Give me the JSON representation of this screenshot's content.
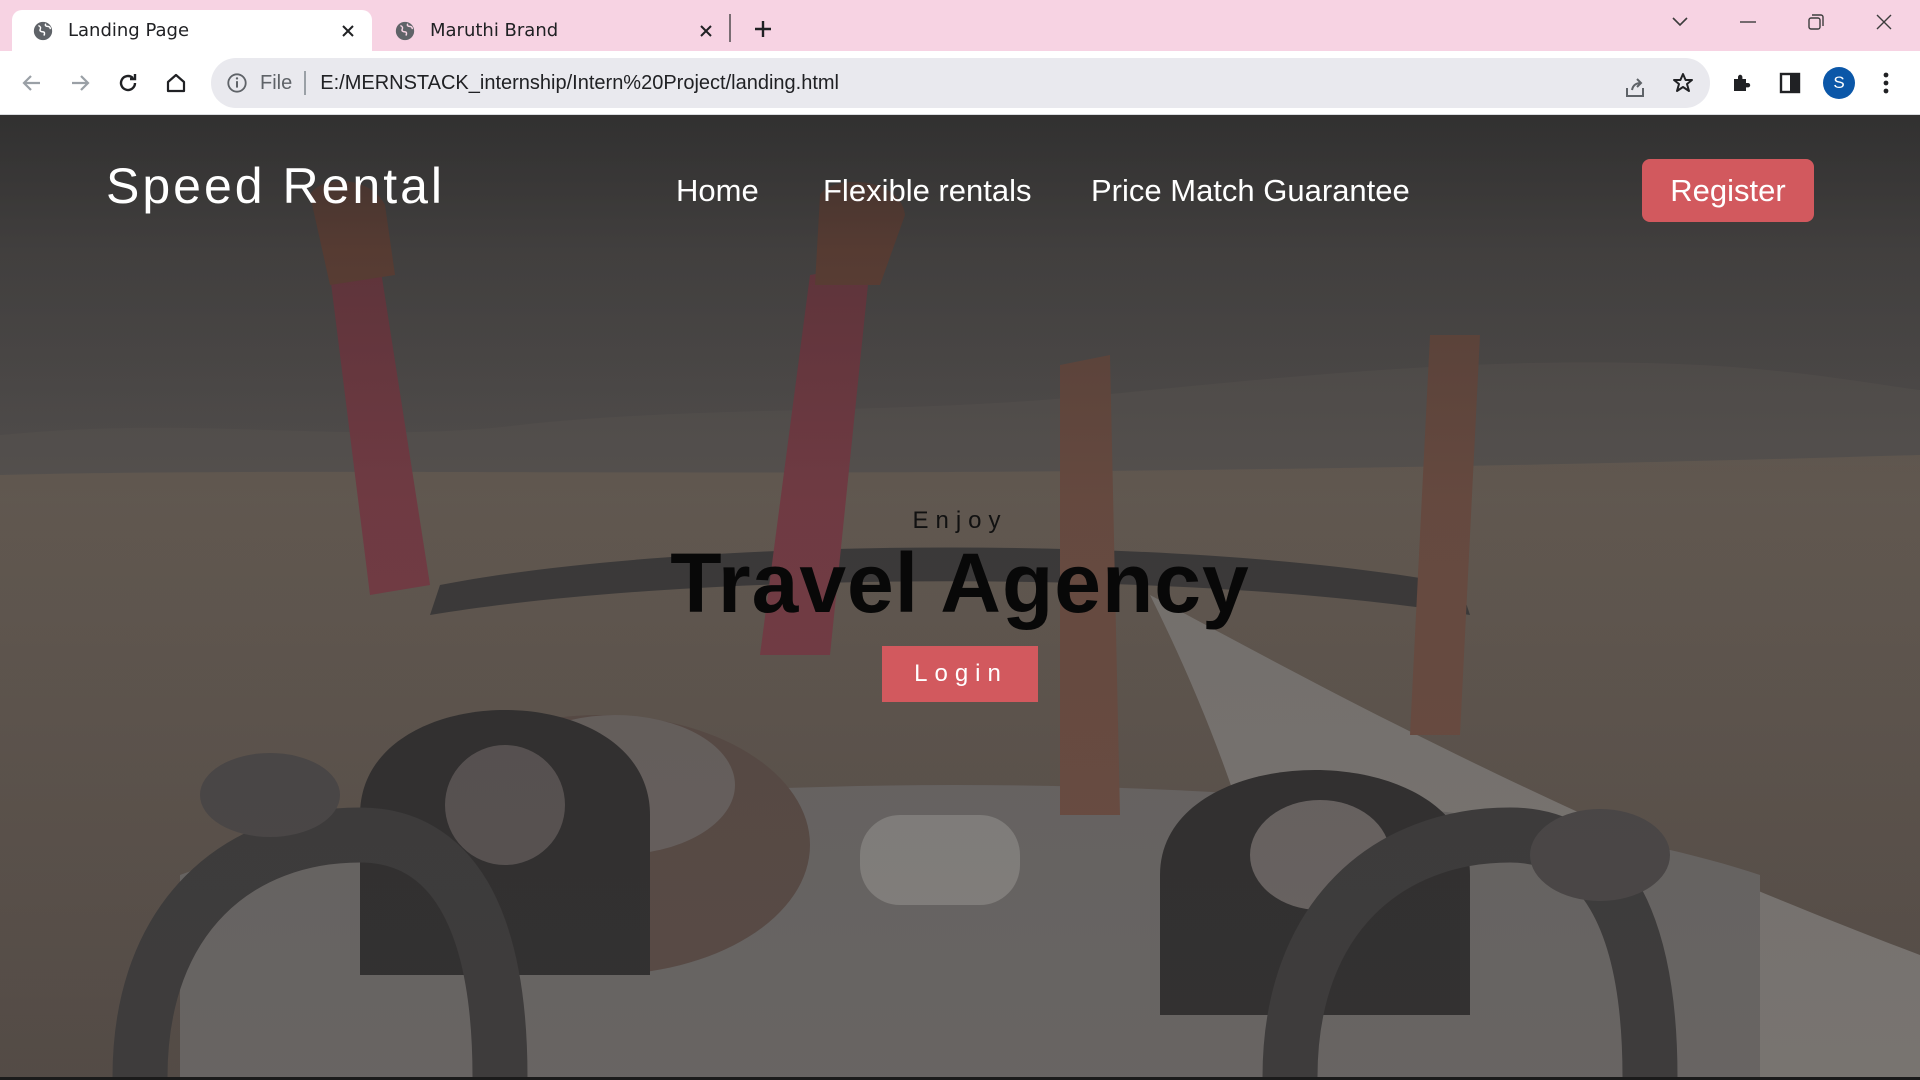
{
  "browser": {
    "tabs": [
      {
        "title": "Landing Page",
        "active": true
      },
      {
        "title": "Maruthi Brand",
        "active": false
      }
    ],
    "address_bar": {
      "scheme_label": "File",
      "url": "E:/MERNSTACK_internship/Intern%20Project/landing.html"
    },
    "profile_initial": "S"
  },
  "page": {
    "brand": "Speed Rental",
    "nav": [
      {
        "label": "Home"
      },
      {
        "label": "Flexible rentals"
      },
      {
        "label": "Price Match Guarantee"
      }
    ],
    "register_label": "Register",
    "hero": {
      "kicker": "Enjoy",
      "headline": "Travel Agency",
      "login_label": "Login"
    }
  },
  "colors": {
    "tab_strip": "#f7d3e3",
    "accent_button": "#d2595e",
    "avatar": "#0b57a8"
  },
  "icons": [
    "globe-icon",
    "close-icon",
    "plus-icon",
    "chevron-down-icon",
    "minimize-icon",
    "restore-icon",
    "window-close-icon",
    "back-arrow-icon",
    "forward-arrow-icon",
    "reload-icon",
    "home-icon",
    "info-icon",
    "share-icon",
    "star-icon",
    "puzzle-icon",
    "side-panel-icon",
    "more-vert-icon"
  ]
}
